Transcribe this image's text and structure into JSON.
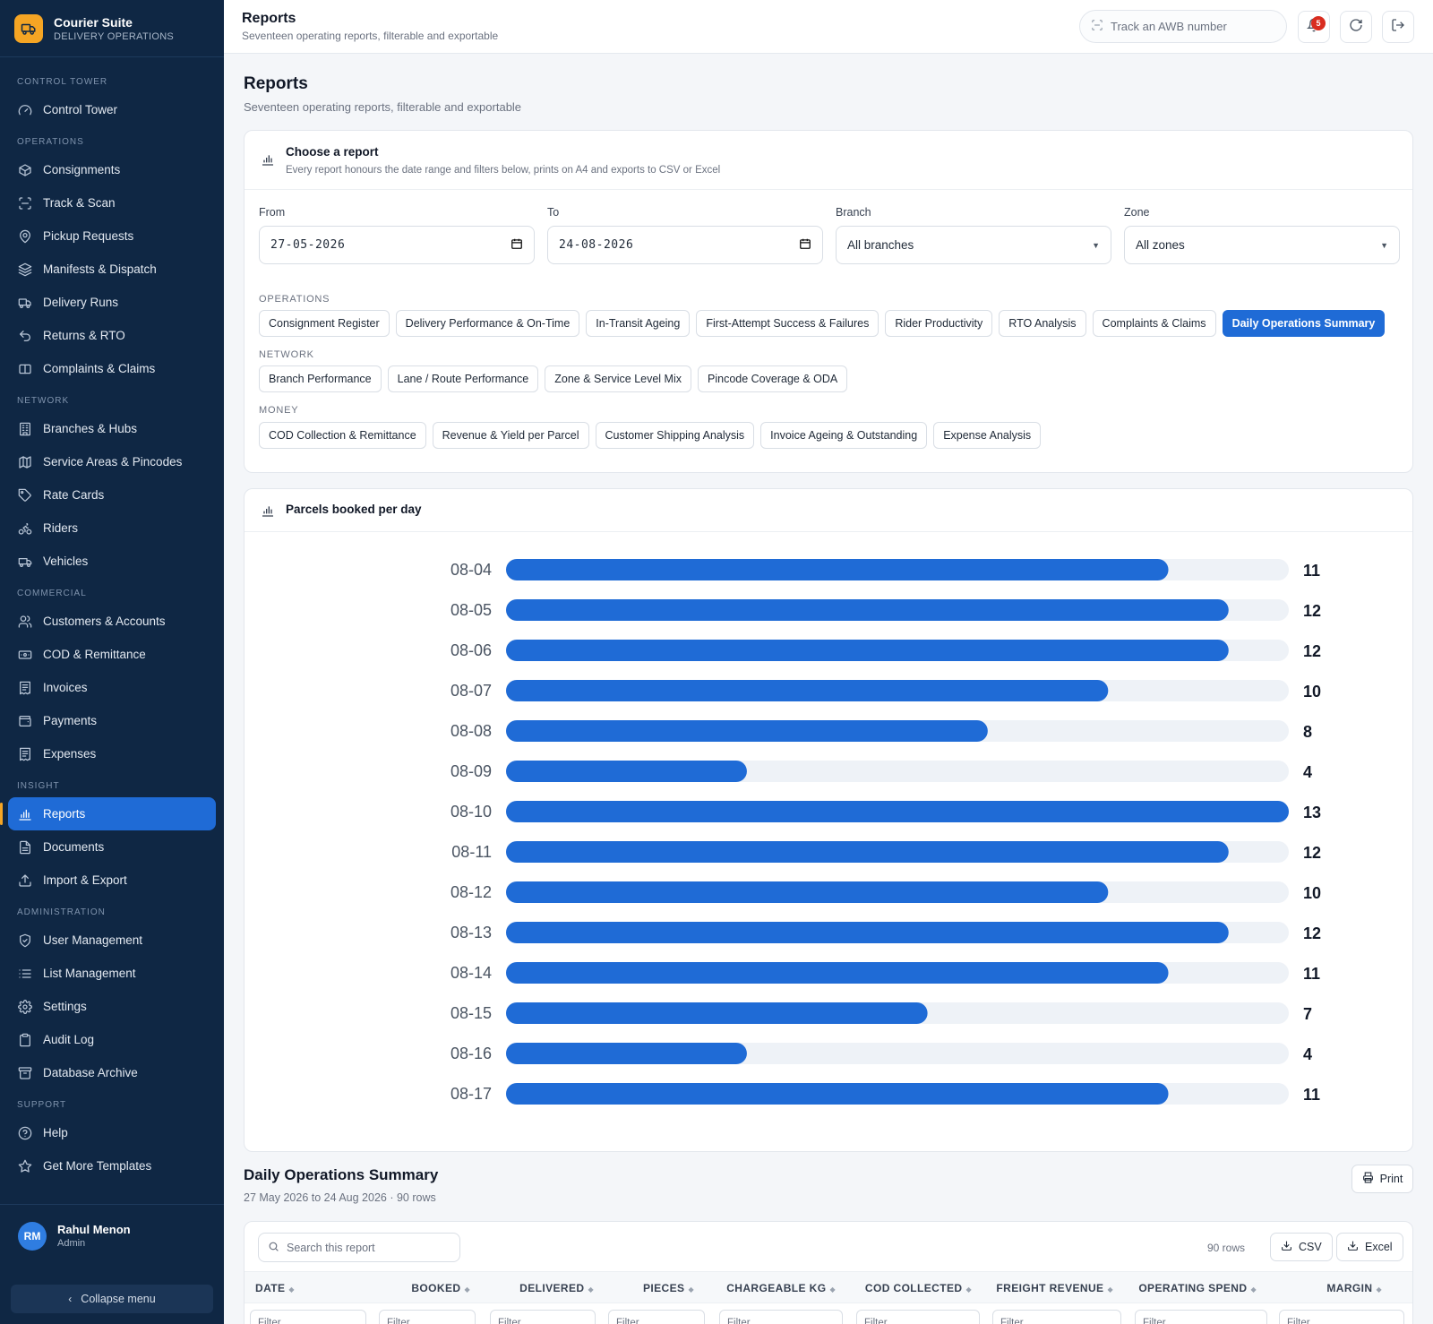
{
  "brand": {
    "title": "Courier Suite",
    "subtitle": "DELIVERY OPERATIONS"
  },
  "sidebar": {
    "sections": [
      {
        "label": "CONTROL TOWER",
        "items": [
          {
            "label": "Control Tower",
            "icon": "gauge-icon"
          }
        ]
      },
      {
        "label": "OPERATIONS",
        "items": [
          {
            "label": "Consignments",
            "icon": "box-icon"
          },
          {
            "label": "Track & Scan",
            "icon": "scan-icon"
          },
          {
            "label": "Pickup Requests",
            "icon": "map-pin-icon"
          },
          {
            "label": "Manifests & Dispatch",
            "icon": "layers-icon"
          },
          {
            "label": "Delivery Runs",
            "icon": "truck-icon"
          },
          {
            "label": "Returns & RTO",
            "icon": "undo-icon"
          },
          {
            "label": "Complaints & Claims",
            "icon": "ticket-icon"
          }
        ]
      },
      {
        "label": "NETWORK",
        "items": [
          {
            "label": "Branches & Hubs",
            "icon": "building-icon"
          },
          {
            "label": "Service Areas & Pincodes",
            "icon": "map-icon"
          },
          {
            "label": "Rate Cards",
            "icon": "tag-icon"
          },
          {
            "label": "Riders",
            "icon": "bike-icon"
          },
          {
            "label": "Vehicles",
            "icon": "van-icon"
          }
        ]
      },
      {
        "label": "COMMERCIAL",
        "items": [
          {
            "label": "Customers & Accounts",
            "icon": "users-icon"
          },
          {
            "label": "COD & Remittance",
            "icon": "cash-icon"
          },
          {
            "label": "Invoices",
            "icon": "receipt-icon"
          },
          {
            "label": "Payments",
            "icon": "wallet-icon"
          },
          {
            "label": "Expenses",
            "icon": "receipt-icon"
          }
        ]
      },
      {
        "label": "INSIGHT",
        "items": [
          {
            "label": "Reports",
            "icon": "bar-chart-icon",
            "active": true
          },
          {
            "label": "Documents",
            "icon": "document-icon"
          },
          {
            "label": "Import & Export",
            "icon": "upload-icon"
          }
        ]
      },
      {
        "label": "ADMINISTRATION",
        "items": [
          {
            "label": "User Management",
            "icon": "shield-icon"
          },
          {
            "label": "List Management",
            "icon": "list-icon"
          },
          {
            "label": "Settings",
            "icon": "gear-icon"
          },
          {
            "label": "Audit Log",
            "icon": "clipboard-icon"
          },
          {
            "label": "Database Archive",
            "icon": "archive-icon"
          }
        ]
      },
      {
        "label": "SUPPORT",
        "items": [
          {
            "label": "Help",
            "icon": "help-icon"
          },
          {
            "label": "Get More Templates",
            "icon": "star-icon"
          }
        ]
      }
    ],
    "user": {
      "initials": "RM",
      "name": "Rahul Menon",
      "role": "Admin"
    },
    "collapse_label": "Collapse menu"
  },
  "topbar": {
    "title": "Reports",
    "subtitle": "Seventeen operating reports, filterable and exportable",
    "awb_placeholder": "Track an AWB number",
    "notification_count": "5"
  },
  "page": {
    "title": "Reports",
    "subtitle": "Seventeen operating reports, filterable and exportable"
  },
  "chooser": {
    "title": "Choose a report",
    "subtitle": "Every report honours the date range and filters below, prints on A4 and exports to CSV or Excel",
    "filters": {
      "from_label": "From",
      "from_value": "27-05-2026",
      "to_label": "To",
      "to_value": "24-08-2026",
      "branch_label": "Branch",
      "branch_value": "All branches",
      "zone_label": "Zone",
      "zone_value": "All zones"
    },
    "groups": [
      {
        "label": "OPERATIONS",
        "reports": [
          "Consignment Register",
          "Delivery Performance & On-Time",
          "In-Transit Ageing",
          "First-Attempt Success & Failures",
          "Rider Productivity",
          "RTO Analysis",
          "Complaints & Claims",
          "Daily Operations Summary"
        ]
      },
      {
        "label": "NETWORK",
        "reports": [
          "Branch Performance",
          "Lane / Route Performance",
          "Zone & Service Level Mix",
          "Pincode Coverage & ODA"
        ]
      },
      {
        "label": "MONEY",
        "reports": [
          "COD Collection & Remittance",
          "Revenue & Yield per Parcel",
          "Customer Shipping Analysis",
          "Invoice Ageing & Outstanding",
          "Expense Analysis"
        ]
      }
    ],
    "active_report": "Daily Operations Summary"
  },
  "chart_data": {
    "type": "bar",
    "orientation": "horizontal",
    "title": "Parcels booked per day",
    "categories": [
      "08-04",
      "08-05",
      "08-06",
      "08-07",
      "08-08",
      "08-09",
      "08-10",
      "08-11",
      "08-12",
      "08-13",
      "08-14",
      "08-15",
      "08-16",
      "08-17"
    ],
    "values": [
      11,
      12,
      12,
      10,
      8,
      4,
      13,
      12,
      10,
      12,
      11,
      7,
      4,
      11
    ],
    "xlim": [
      0,
      13
    ],
    "grid": false,
    "colors": {
      "bar": "#1f6bd6",
      "track": "#eef2f7"
    }
  },
  "summary": {
    "title": "Daily Operations Summary",
    "subtitle": "27 May 2026 to 24 Aug 2026 · 90 rows",
    "print_label": "Print",
    "search_placeholder": "Search this report",
    "rows_count": "90 rows",
    "csv_label": "CSV",
    "excel_label": "Excel",
    "columns": [
      "DATE",
      "BOOKED",
      "DELIVERED",
      "PIECES",
      "CHARGEABLE KG",
      "COD COLLECTED",
      "FREIGHT REVENUE",
      "OPERATING SPEND",
      "MARGIN"
    ],
    "filter_placeholder": "Filter"
  },
  "colors": {
    "sidebar_bg": "#0f2744",
    "accent": "#1f6bd6",
    "brand": "#f5a524"
  }
}
